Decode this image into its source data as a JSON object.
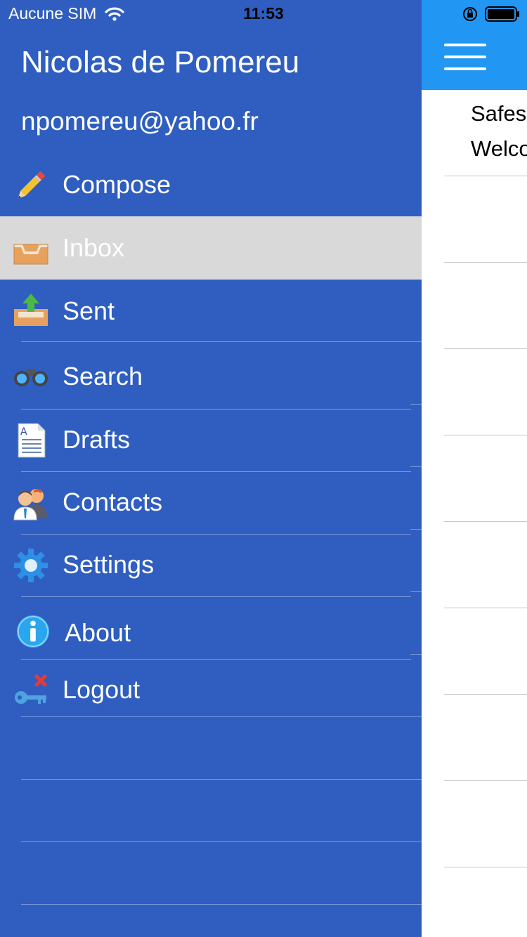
{
  "status_bar": {
    "carrier": "Aucune SIM",
    "time": "11:53"
  },
  "account": {
    "name": "Nicolas de Pomereu",
    "email": "npomereu@yahoo.fr"
  },
  "menu": {
    "items": [
      {
        "label": "Compose",
        "icon": "pencil-icon"
      },
      {
        "label": "Inbox",
        "icon": "inbox-tray-icon",
        "active": true
      },
      {
        "label": "Sent",
        "icon": "outbox-upload-icon"
      },
      {
        "label": "Search",
        "icon": "binoculars-icon"
      },
      {
        "label": "Drafts",
        "icon": "document-icon"
      },
      {
        "label": "Contacts",
        "icon": "contacts-people-icon"
      },
      {
        "label": "Settings",
        "icon": "gear-icon"
      },
      {
        "label": "About",
        "icon": "info-icon"
      },
      {
        "label": "Logout",
        "icon": "key-x-icon"
      }
    ]
  },
  "inbox": {
    "messages": [
      {
        "from": "Safes",
        "subject": "Welco"
      }
    ]
  },
  "colors": {
    "drawer_bg": "#2f5ec0",
    "active_item_bg": "#d9d9d9",
    "header_bg": "#2196f3"
  }
}
